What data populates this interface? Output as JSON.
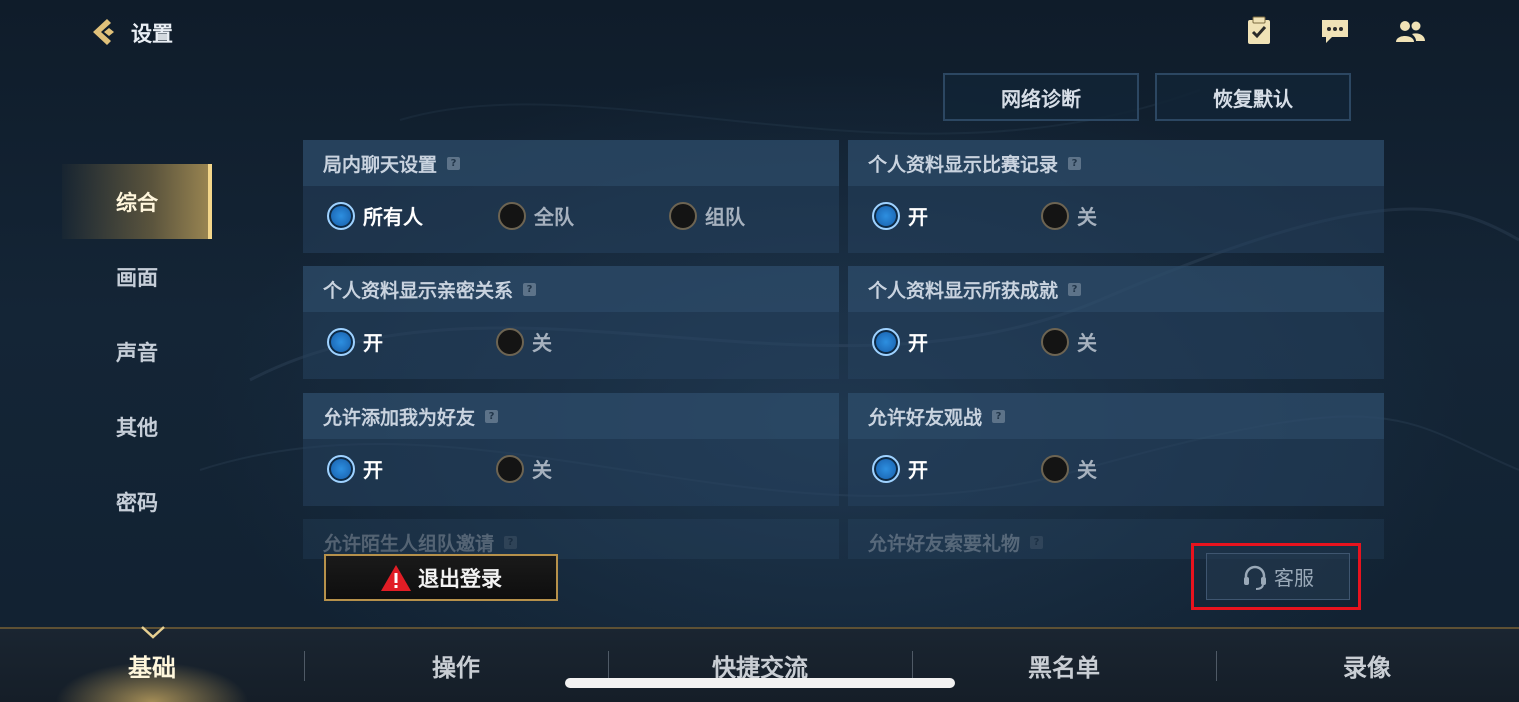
{
  "header": {
    "title": "设置"
  },
  "top_actions": {
    "network": "网络诊断",
    "reset": "恢复默认"
  },
  "side_nav": [
    {
      "label": "综合",
      "active": true
    },
    {
      "label": "画面",
      "active": false
    },
    {
      "label": "声音",
      "active": false
    },
    {
      "label": "其他",
      "active": false
    },
    {
      "label": "密码",
      "active": false
    }
  ],
  "panels": {
    "p1": {
      "title": "局内聊天设置",
      "options": [
        "所有人",
        "全队",
        "组队"
      ],
      "selected": "所有人"
    },
    "p2": {
      "title": "个人资料显示比赛记录",
      "options": [
        "开",
        "关"
      ],
      "selected": "开"
    },
    "p3": {
      "title": "个人资料显示亲密关系",
      "options": [
        "开",
        "关"
      ],
      "selected": "开"
    },
    "p4": {
      "title": "个人资料显示所获成就",
      "options": [
        "开",
        "关"
      ],
      "selected": "开"
    },
    "p5": {
      "title": "允许添加我为好友",
      "options": [
        "开",
        "关"
      ],
      "selected": "开"
    },
    "p6": {
      "title": "允许好友观战",
      "options": [
        "开",
        "关"
      ],
      "selected": "开"
    },
    "p7": {
      "title": "允许陌生人组队邀请"
    },
    "p8": {
      "title": "允许好友索要礼物"
    }
  },
  "help_glyph": "?",
  "logout_label": "退出登录",
  "service_label": "客服",
  "bottom_tabs": [
    "基础",
    "操作",
    "快捷交流",
    "黑名单",
    "录像"
  ],
  "icons": [
    "back-arrow-icon",
    "task-checklist-icon",
    "chat-icon",
    "friends-icon",
    "warning-icon",
    "headset-icon"
  ],
  "colors": {
    "accent_gold": "#f3d68a",
    "radio_on": "#2d8fe0",
    "highlight": "#e8131e"
  }
}
